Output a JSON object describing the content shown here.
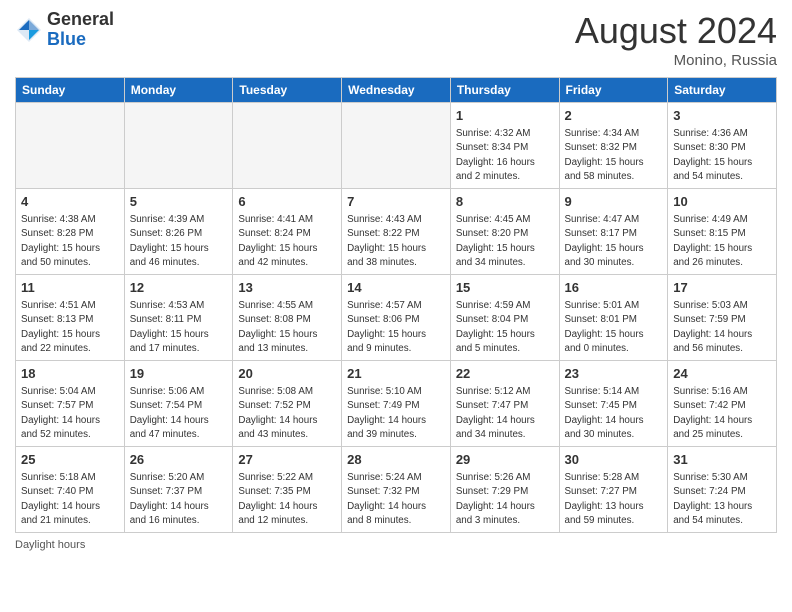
{
  "header": {
    "logo_general": "General",
    "logo_blue": "Blue",
    "month_year": "August 2024",
    "location": "Monino, Russia"
  },
  "footer": {
    "label": "Daylight hours"
  },
  "weekdays": [
    "Sunday",
    "Monday",
    "Tuesday",
    "Wednesday",
    "Thursday",
    "Friday",
    "Saturday"
  ],
  "weeks": [
    [
      {
        "day": "",
        "info": ""
      },
      {
        "day": "",
        "info": ""
      },
      {
        "day": "",
        "info": ""
      },
      {
        "day": "",
        "info": ""
      },
      {
        "day": "1",
        "info": "Sunrise: 4:32 AM\nSunset: 8:34 PM\nDaylight: 16 hours\nand 2 minutes."
      },
      {
        "day": "2",
        "info": "Sunrise: 4:34 AM\nSunset: 8:32 PM\nDaylight: 15 hours\nand 58 minutes."
      },
      {
        "day": "3",
        "info": "Sunrise: 4:36 AM\nSunset: 8:30 PM\nDaylight: 15 hours\nand 54 minutes."
      }
    ],
    [
      {
        "day": "4",
        "info": "Sunrise: 4:38 AM\nSunset: 8:28 PM\nDaylight: 15 hours\nand 50 minutes."
      },
      {
        "day": "5",
        "info": "Sunrise: 4:39 AM\nSunset: 8:26 PM\nDaylight: 15 hours\nand 46 minutes."
      },
      {
        "day": "6",
        "info": "Sunrise: 4:41 AM\nSunset: 8:24 PM\nDaylight: 15 hours\nand 42 minutes."
      },
      {
        "day": "7",
        "info": "Sunrise: 4:43 AM\nSunset: 8:22 PM\nDaylight: 15 hours\nand 38 minutes."
      },
      {
        "day": "8",
        "info": "Sunrise: 4:45 AM\nSunset: 8:20 PM\nDaylight: 15 hours\nand 34 minutes."
      },
      {
        "day": "9",
        "info": "Sunrise: 4:47 AM\nSunset: 8:17 PM\nDaylight: 15 hours\nand 30 minutes."
      },
      {
        "day": "10",
        "info": "Sunrise: 4:49 AM\nSunset: 8:15 PM\nDaylight: 15 hours\nand 26 minutes."
      }
    ],
    [
      {
        "day": "11",
        "info": "Sunrise: 4:51 AM\nSunset: 8:13 PM\nDaylight: 15 hours\nand 22 minutes."
      },
      {
        "day": "12",
        "info": "Sunrise: 4:53 AM\nSunset: 8:11 PM\nDaylight: 15 hours\nand 17 minutes."
      },
      {
        "day": "13",
        "info": "Sunrise: 4:55 AM\nSunset: 8:08 PM\nDaylight: 15 hours\nand 13 minutes."
      },
      {
        "day": "14",
        "info": "Sunrise: 4:57 AM\nSunset: 8:06 PM\nDaylight: 15 hours\nand 9 minutes."
      },
      {
        "day": "15",
        "info": "Sunrise: 4:59 AM\nSunset: 8:04 PM\nDaylight: 15 hours\nand 5 minutes."
      },
      {
        "day": "16",
        "info": "Sunrise: 5:01 AM\nSunset: 8:01 PM\nDaylight: 15 hours\nand 0 minutes."
      },
      {
        "day": "17",
        "info": "Sunrise: 5:03 AM\nSunset: 7:59 PM\nDaylight: 14 hours\nand 56 minutes."
      }
    ],
    [
      {
        "day": "18",
        "info": "Sunrise: 5:04 AM\nSunset: 7:57 PM\nDaylight: 14 hours\nand 52 minutes."
      },
      {
        "day": "19",
        "info": "Sunrise: 5:06 AM\nSunset: 7:54 PM\nDaylight: 14 hours\nand 47 minutes."
      },
      {
        "day": "20",
        "info": "Sunrise: 5:08 AM\nSunset: 7:52 PM\nDaylight: 14 hours\nand 43 minutes."
      },
      {
        "day": "21",
        "info": "Sunrise: 5:10 AM\nSunset: 7:49 PM\nDaylight: 14 hours\nand 39 minutes."
      },
      {
        "day": "22",
        "info": "Sunrise: 5:12 AM\nSunset: 7:47 PM\nDaylight: 14 hours\nand 34 minutes."
      },
      {
        "day": "23",
        "info": "Sunrise: 5:14 AM\nSunset: 7:45 PM\nDaylight: 14 hours\nand 30 minutes."
      },
      {
        "day": "24",
        "info": "Sunrise: 5:16 AM\nSunset: 7:42 PM\nDaylight: 14 hours\nand 25 minutes."
      }
    ],
    [
      {
        "day": "25",
        "info": "Sunrise: 5:18 AM\nSunset: 7:40 PM\nDaylight: 14 hours\nand 21 minutes."
      },
      {
        "day": "26",
        "info": "Sunrise: 5:20 AM\nSunset: 7:37 PM\nDaylight: 14 hours\nand 16 minutes."
      },
      {
        "day": "27",
        "info": "Sunrise: 5:22 AM\nSunset: 7:35 PM\nDaylight: 14 hours\nand 12 minutes."
      },
      {
        "day": "28",
        "info": "Sunrise: 5:24 AM\nSunset: 7:32 PM\nDaylight: 14 hours\nand 8 minutes."
      },
      {
        "day": "29",
        "info": "Sunrise: 5:26 AM\nSunset: 7:29 PM\nDaylight: 14 hours\nand 3 minutes."
      },
      {
        "day": "30",
        "info": "Sunrise: 5:28 AM\nSunset: 7:27 PM\nDaylight: 13 hours\nand 59 minutes."
      },
      {
        "day": "31",
        "info": "Sunrise: 5:30 AM\nSunset: 7:24 PM\nDaylight: 13 hours\nand 54 minutes."
      }
    ]
  ]
}
